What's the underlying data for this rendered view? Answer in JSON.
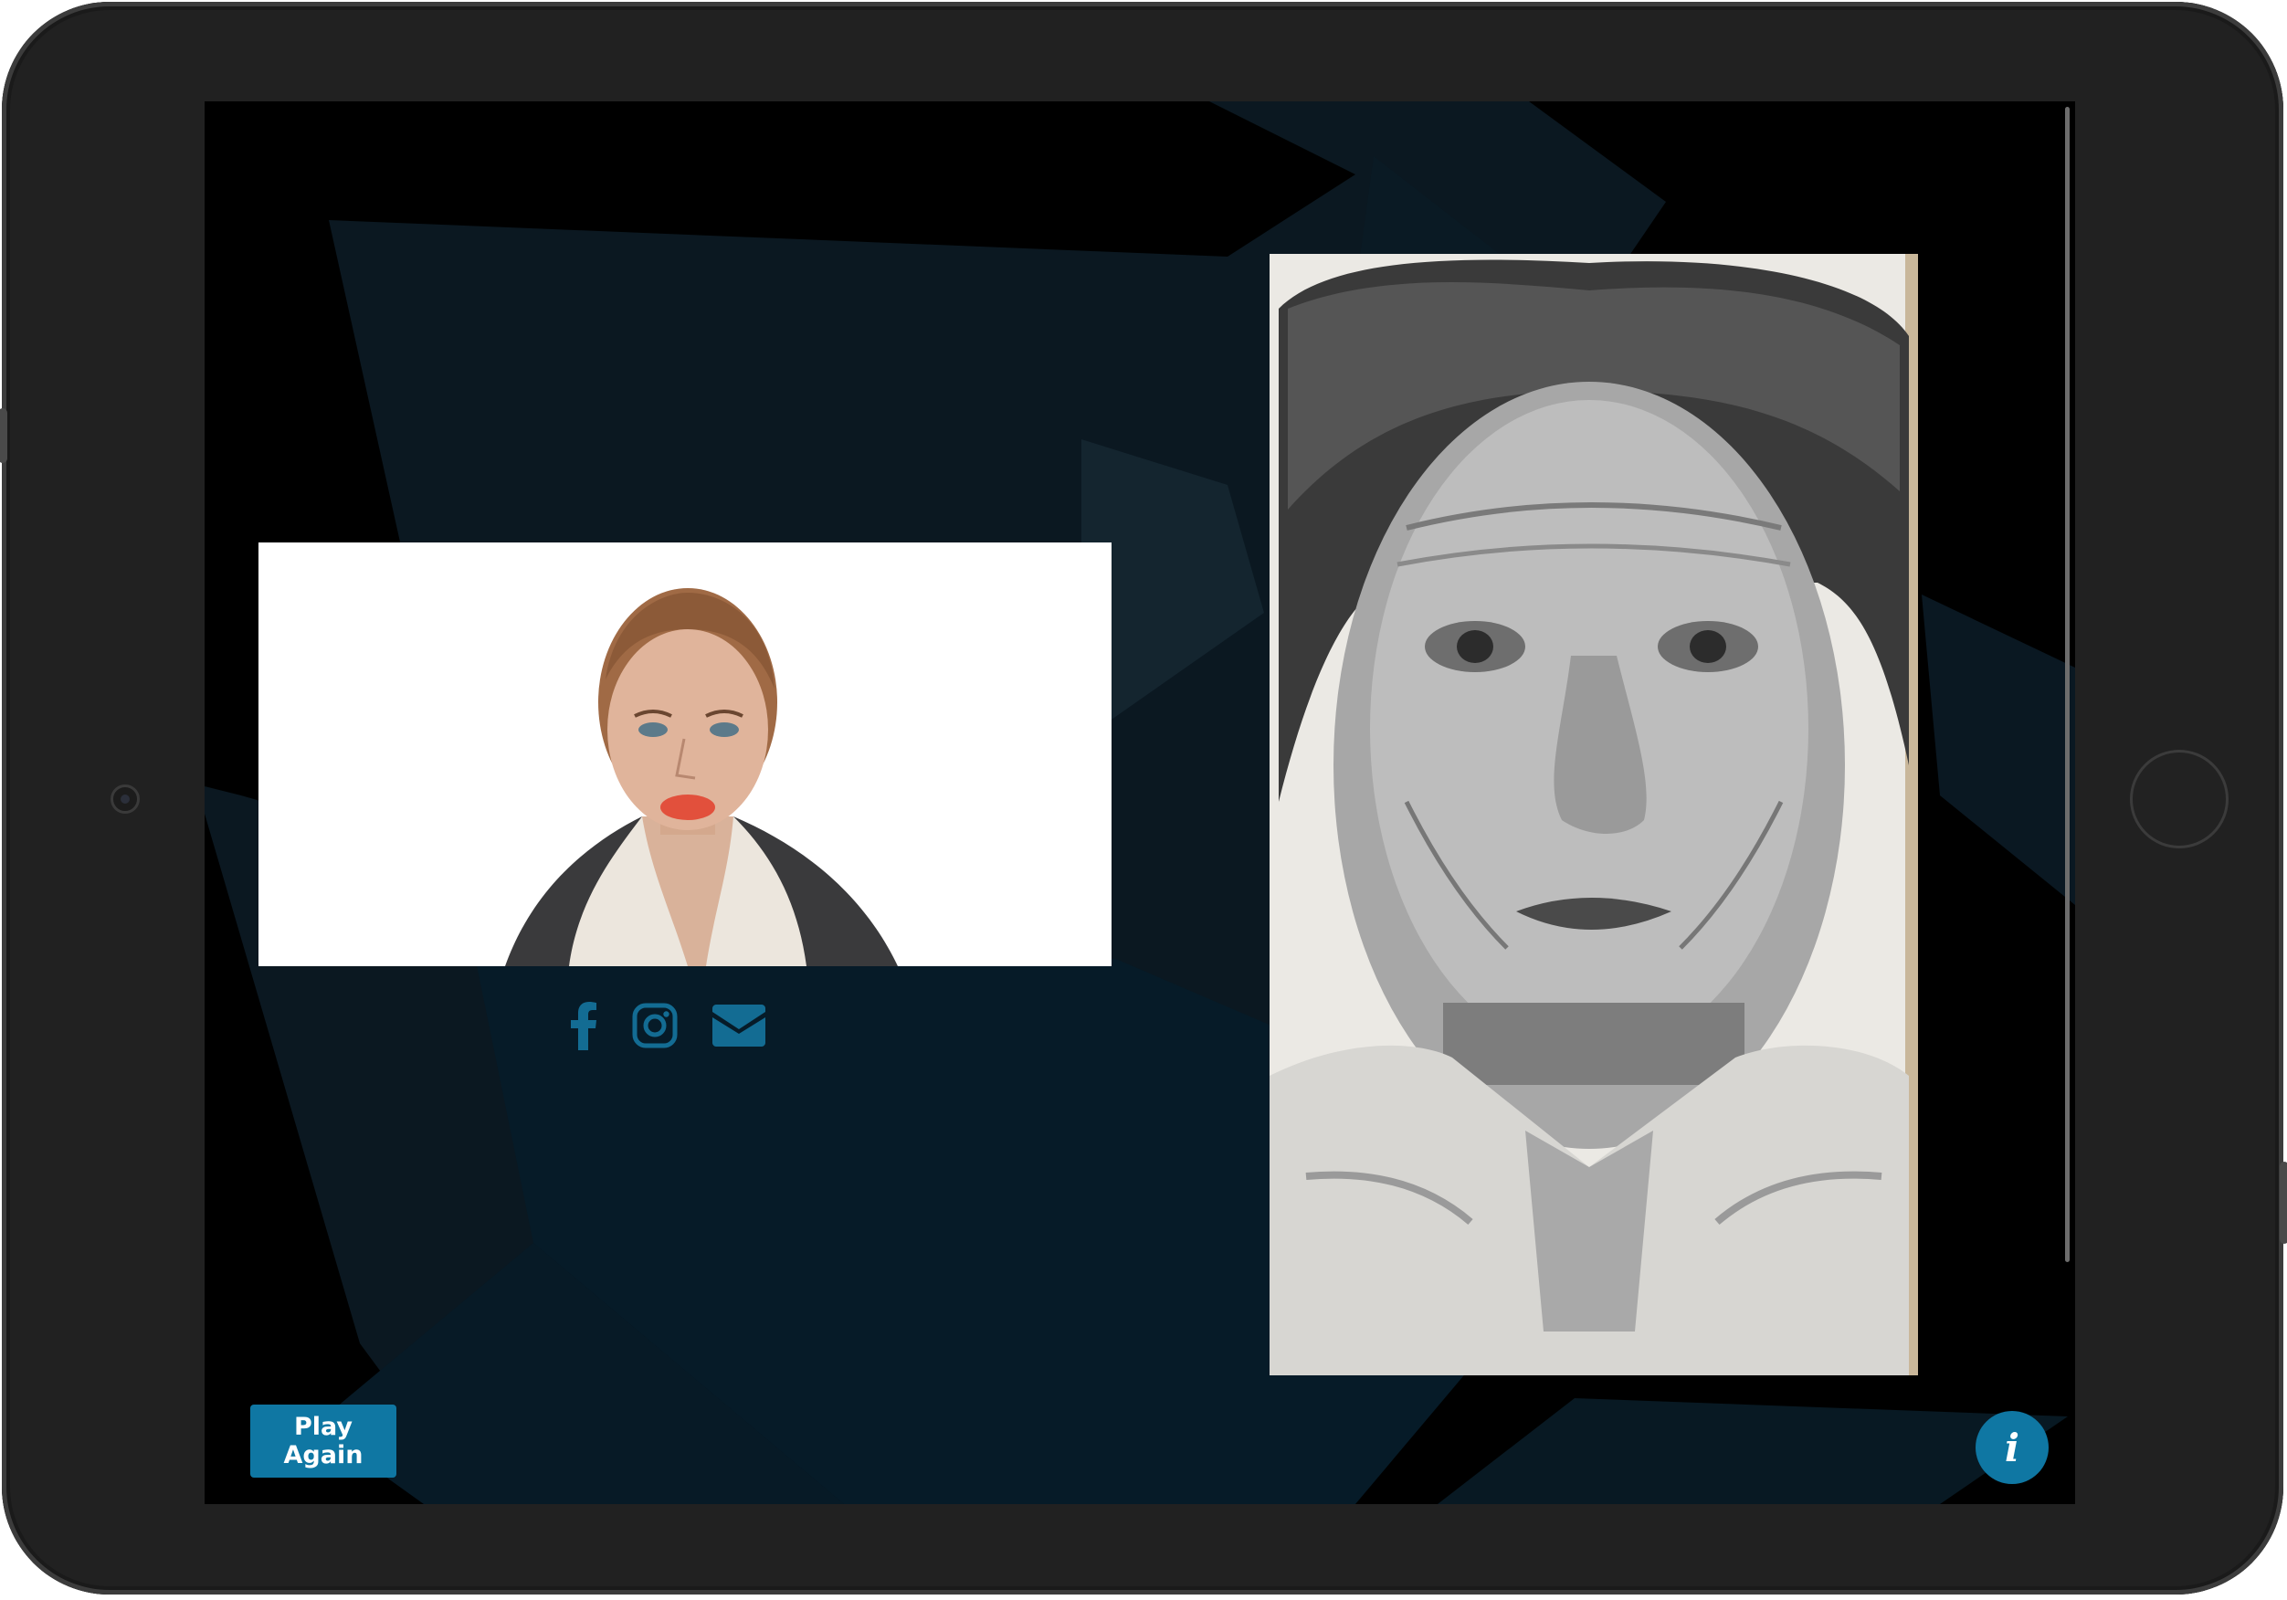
{
  "device": {
    "frame_color": "#212121",
    "screen_background": "#000000"
  },
  "theme": {
    "accent": "#0f77a3",
    "icon_color": "#136c93",
    "shard_dark": "#0c1b27",
    "shard_mid": "#062030"
  },
  "main": {
    "photo": {
      "icon": "portrait-photo"
    },
    "sketch": {
      "icon": "pencil-sketch-portrait"
    },
    "social": [
      {
        "name": "facebook",
        "icon": "facebook-icon"
      },
      {
        "name": "instagram",
        "icon": "instagram-icon"
      },
      {
        "name": "email",
        "icon": "envelope-icon"
      }
    ]
  },
  "footer": {
    "play_again_label": "Play Again",
    "info_label": "i"
  }
}
